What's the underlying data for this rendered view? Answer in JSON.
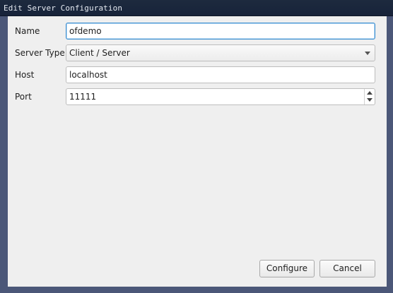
{
  "window": {
    "title": "Edit Server Configuration"
  },
  "form": {
    "name": {
      "label": "Name",
      "value": "ofdemo"
    },
    "server_type": {
      "label": "Server Type",
      "value": "Client / Server"
    },
    "host": {
      "label": "Host",
      "value": "localhost"
    },
    "port": {
      "label": "Port",
      "value": "11111"
    }
  },
  "buttons": {
    "configure": "Configure",
    "cancel": "Cancel"
  },
  "colors": {
    "accent_focus": "#3e8fd0",
    "titlebar": "#1d2a3e",
    "frame": "#4b5778",
    "dialog_bg": "#efefef"
  },
  "icons": {
    "combo_arrow": "chevron-down-icon",
    "spin_up": "spin-up-icon",
    "spin_down": "spin-down-icon"
  }
}
